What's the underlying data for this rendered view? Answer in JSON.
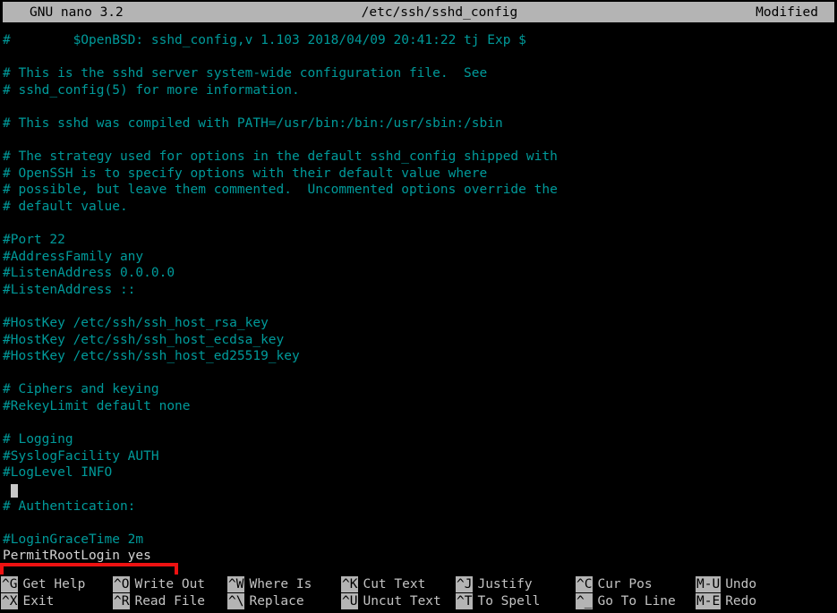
{
  "titlebar": {
    "version": "GNU nano 3.2",
    "filename": "/etc/ssh/sshd_config",
    "status": "Modified"
  },
  "colors": {
    "background": "#000000",
    "comment_text": "#009a9a",
    "active_text": "#d4d4d4",
    "titlebar_bg": "#b4b4b4",
    "titlebar_fg": "#000000",
    "help_key_bg": "#b4b4b4",
    "help_label_fg": "#c2c2c2",
    "annotation_box": "#ee1212"
  },
  "editor": {
    "cursor_line_index": 27,
    "cursor_column": 19,
    "lines": [
      {
        "text": "#\t$OpenBSD: sshd_config,v 1.103 2018/04/09 20:41:22 tj Exp $",
        "kind": "comment"
      },
      {
        "text": "",
        "kind": "blank"
      },
      {
        "text": "# This is the sshd server system-wide configuration file.  See",
        "kind": "comment"
      },
      {
        "text": "# sshd_config(5) for more information.",
        "kind": "comment"
      },
      {
        "text": "",
        "kind": "blank"
      },
      {
        "text": "# This sshd was compiled with PATH=/usr/bin:/bin:/usr/sbin:/sbin",
        "kind": "comment"
      },
      {
        "text": "",
        "kind": "blank"
      },
      {
        "text": "# The strategy used for options in the default sshd_config shipped with",
        "kind": "comment"
      },
      {
        "text": "# OpenSSH is to specify options with their default value where",
        "kind": "comment"
      },
      {
        "text": "# possible, but leave them commented.  Uncommented options override the",
        "kind": "comment"
      },
      {
        "text": "# default value.",
        "kind": "comment"
      },
      {
        "text": "",
        "kind": "blank"
      },
      {
        "text": "#Port 22",
        "kind": "comment"
      },
      {
        "text": "#AddressFamily any",
        "kind": "comment"
      },
      {
        "text": "#ListenAddress 0.0.0.0",
        "kind": "comment"
      },
      {
        "text": "#ListenAddress ::",
        "kind": "comment"
      },
      {
        "text": "",
        "kind": "blank"
      },
      {
        "text": "#HostKey /etc/ssh/ssh_host_rsa_key",
        "kind": "comment"
      },
      {
        "text": "#HostKey /etc/ssh/ssh_host_ecdsa_key",
        "kind": "comment"
      },
      {
        "text": "#HostKey /etc/ssh/ssh_host_ed25519_key",
        "kind": "comment"
      },
      {
        "text": "",
        "kind": "blank"
      },
      {
        "text": "# Ciphers and keying",
        "kind": "comment"
      },
      {
        "text": "#RekeyLimit default none",
        "kind": "comment"
      },
      {
        "text": "",
        "kind": "blank"
      },
      {
        "text": "# Logging",
        "kind": "comment"
      },
      {
        "text": "#SyslogFacility AUTH",
        "kind": "comment"
      },
      {
        "text": "#LogLevel INFO",
        "kind": "comment"
      },
      {
        "text": "",
        "kind": "blank"
      },
      {
        "text": "# Authentication:",
        "kind": "comment"
      },
      {
        "text": "",
        "kind": "blank"
      },
      {
        "text": "#LoginGraceTime 2m",
        "kind": "comment"
      },
      {
        "text": "PermitRootLogin yes",
        "kind": "active"
      }
    ]
  },
  "helpbar": {
    "columns": [
      {
        "top": {
          "key": "^G",
          "label": "Get Help"
        },
        "bottom": {
          "key": "^X",
          "label": "Exit"
        }
      },
      {
        "top": {
          "key": "^O",
          "label": "Write Out"
        },
        "bottom": {
          "key": "^R",
          "label": "Read File"
        }
      },
      {
        "top": {
          "key": "^W",
          "label": "Where Is"
        },
        "bottom": {
          "key": "^\\",
          "label": "Replace"
        }
      },
      {
        "top": {
          "key": "^K",
          "label": "Cut Text"
        },
        "bottom": {
          "key": "^U",
          "label": "Uncut Text"
        }
      },
      {
        "top": {
          "key": "^J",
          "label": "Justify"
        },
        "bottom": {
          "key": "^T",
          "label": "To Spell"
        }
      },
      {
        "top": {
          "key": "^C",
          "label": "Cur Pos"
        },
        "bottom": {
          "key": "^_",
          "label": "Go To Line"
        }
      },
      {
        "top": {
          "key": "M-U",
          "label": "Undo"
        },
        "bottom": {
          "key": "M-E",
          "label": "Redo"
        }
      }
    ]
  }
}
